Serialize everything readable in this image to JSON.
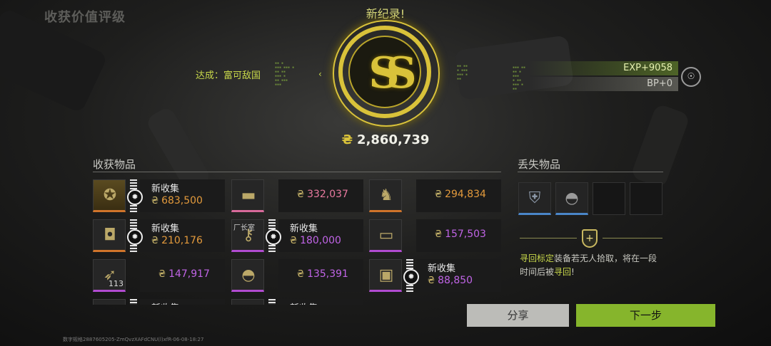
{
  "page_title": "收获价值评级",
  "badge": {
    "title": "新纪录!",
    "grade": "SS",
    "value_icon": "coin-icon",
    "value": "2,860,739"
  },
  "achievement": {
    "text": "达成：富可敌国",
    "arrow": "‹"
  },
  "rewards": {
    "exp": "EXP+9058",
    "bp": "BP+0"
  },
  "loot": {
    "title": "收获物品",
    "new_label": "新收集",
    "items": [
      {
        "icon": "medal-icon",
        "glyph": "✪",
        "new": true,
        "value": "683,500",
        "rarity": "orange"
      },
      {
        "icon": "rifle-icon",
        "glyph": "▬",
        "new": false,
        "value": "332,037",
        "rarity": "pink"
      },
      {
        "icon": "trophy-icon",
        "glyph": "♞",
        "new": false,
        "value": "294,834",
        "rarity": "orange"
      },
      {
        "icon": "grenade-icon",
        "glyph": "◘",
        "new": true,
        "value": "210,176",
        "rarity": "orange"
      },
      {
        "icon": "key-icon",
        "glyph": "⚷",
        "new": true,
        "value": "180,000",
        "rarity": "purple",
        "tag": "厂长室"
      },
      {
        "icon": "scope-icon",
        "glyph": "▭",
        "new": false,
        "value": "157,503",
        "rarity": "purple"
      },
      {
        "icon": "ammo-icon",
        "glyph": "➶",
        "new": false,
        "value": "147,917",
        "rarity": "purple",
        "qty": "113"
      },
      {
        "icon": "helmet-icon",
        "glyph": "◓",
        "new": false,
        "value": "135,391",
        "rarity": "purple"
      },
      {
        "icon": "armor-plate-icon",
        "glyph": "▣",
        "new": true,
        "value": "88,850",
        "rarity": "purple"
      },
      {
        "icon": "item-icon",
        "glyph": "",
        "new": true,
        "value": "",
        "rarity": "none"
      },
      {
        "icon": "item-icon",
        "glyph": "",
        "new": true,
        "value": "",
        "rarity": "none"
      }
    ]
  },
  "lost": {
    "title": "丢失物品",
    "slots": [
      {
        "icon": "vest-icon",
        "glyph": "⛨"
      },
      {
        "icon": "helmet-icon",
        "glyph": "◓"
      },
      {
        "icon": "empty-slot",
        "glyph": ""
      },
      {
        "icon": "empty-slot",
        "glyph": ""
      }
    ],
    "recover_highlight": "寻回标定",
    "recover_text": "装备若无人拾取，将在一段时间后被",
    "recover_highlight2": "寻回",
    "recover_end": "!"
  },
  "buttons": {
    "share": "分享",
    "next": "下一步"
  },
  "footer_id": "数字规格2887605205-ZmQvzXAFdCNU(l)xfR-06-08-18:27"
}
